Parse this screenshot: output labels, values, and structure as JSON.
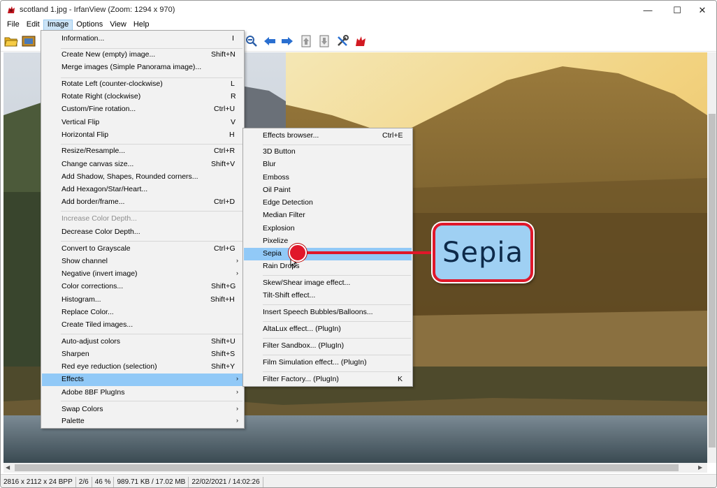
{
  "window": {
    "title": "scotland 1.jpg - IrfanView (Zoom: 1294 x 970)",
    "minimize_glyph": "—",
    "maximize_glyph": "☐",
    "close_glyph": "✕"
  },
  "menubar": {
    "items": [
      "File",
      "Edit",
      "Image",
      "Options",
      "View",
      "Help"
    ],
    "active": "Image"
  },
  "toolbar": {
    "icons": [
      "open-folder-icon",
      "slideshow-icon",
      "zoom-out-icon",
      "arrow-left-icon",
      "arrow-right-icon",
      "page-up-icon",
      "page-down-icon",
      "tools-icon",
      "irfanview-cat-icon"
    ]
  },
  "image_menu": {
    "items": [
      {
        "label": "Information...",
        "accel": "I"
      },
      {
        "label": "Create New (empty) image...",
        "accel": "Shift+N"
      },
      {
        "label": "Merge images (Simple Panorama image)...",
        "accel": ""
      },
      {
        "label": "Rotate Left (counter-clockwise)",
        "accel": "L"
      },
      {
        "label": "Rotate Right (clockwise)",
        "accel": "R"
      },
      {
        "label": "Custom/Fine rotation...",
        "accel": "Ctrl+U"
      },
      {
        "label": "Vertical Flip",
        "accel": "V"
      },
      {
        "label": "Horizontal Flip",
        "accel": "H"
      },
      {
        "label": "Resize/Resample...",
        "accel": "Ctrl+R"
      },
      {
        "label": "Change canvas size...",
        "accel": "Shift+V"
      },
      {
        "label": "Add Shadow, Shapes, Rounded corners...",
        "accel": ""
      },
      {
        "label": "Add Hexagon/Star/Heart...",
        "accel": ""
      },
      {
        "label": "Add border/frame...",
        "accel": "Ctrl+D"
      },
      {
        "label": "Increase Color Depth...",
        "accel": ""
      },
      {
        "label": "Decrease Color Depth...",
        "accel": ""
      },
      {
        "label": "Convert to Grayscale",
        "accel": "Ctrl+G"
      },
      {
        "label": "Show channel",
        "accel": ""
      },
      {
        "label": "Negative (invert image)",
        "accel": ""
      },
      {
        "label": "Color corrections...",
        "accel": "Shift+G"
      },
      {
        "label": "Histogram...",
        "accel": "Shift+H"
      },
      {
        "label": "Replace Color...",
        "accel": ""
      },
      {
        "label": "Create Tiled images...",
        "accel": ""
      },
      {
        "label": "Auto-adjust colors",
        "accel": "Shift+U"
      },
      {
        "label": "Sharpen",
        "accel": "Shift+S"
      },
      {
        "label": "Red eye reduction (selection)",
        "accel": "Shift+Y"
      },
      {
        "label": "Effects",
        "accel": ""
      },
      {
        "label": "Adobe 8BF PlugIns",
        "accel": ""
      },
      {
        "label": "Swap Colors",
        "accel": ""
      },
      {
        "label": "Palette",
        "accel": ""
      }
    ]
  },
  "effects_menu": {
    "items": [
      {
        "label": "Effects browser...",
        "accel": "Ctrl+E"
      },
      {
        "label": "3D Button",
        "accel": ""
      },
      {
        "label": "Blur",
        "accel": ""
      },
      {
        "label": "Emboss",
        "accel": ""
      },
      {
        "label": "Oil Paint",
        "accel": ""
      },
      {
        "label": "Edge Detection",
        "accel": ""
      },
      {
        "label": "Median Filter",
        "accel": ""
      },
      {
        "label": "Explosion",
        "accel": ""
      },
      {
        "label": "Pixelize",
        "accel": ""
      },
      {
        "label": "Sepia",
        "accel": ""
      },
      {
        "label": "Rain Drops",
        "accel": ""
      },
      {
        "label": "Skew/Shear image effect...",
        "accel": ""
      },
      {
        "label": "Tilt-Shift effect...",
        "accel": ""
      },
      {
        "label": "Insert Speech Bubbles/Balloons...",
        "accel": ""
      },
      {
        "label": "AltaLux effect... (PlugIn)",
        "accel": ""
      },
      {
        "label": "Filter Sandbox... (PlugIn)",
        "accel": ""
      },
      {
        "label": "Film Simulation effect... (PlugIn)",
        "accel": ""
      },
      {
        "label": "Filter Factory... (PlugIn)",
        "accel": "K"
      }
    ]
  },
  "callout": {
    "text": "Sepia"
  },
  "statusbar": {
    "dimensions": "2816 x 2112 x 24 BPP",
    "page": "2/6",
    "zoom": "46 %",
    "size": "989.71 KB / 17.02 MB",
    "datetime": "22/02/2021 / 14:02:26"
  },
  "colors": {
    "highlight": "#91c9f7",
    "callout_red": "#e0172a",
    "callout_fill": "#9fd0f3"
  }
}
